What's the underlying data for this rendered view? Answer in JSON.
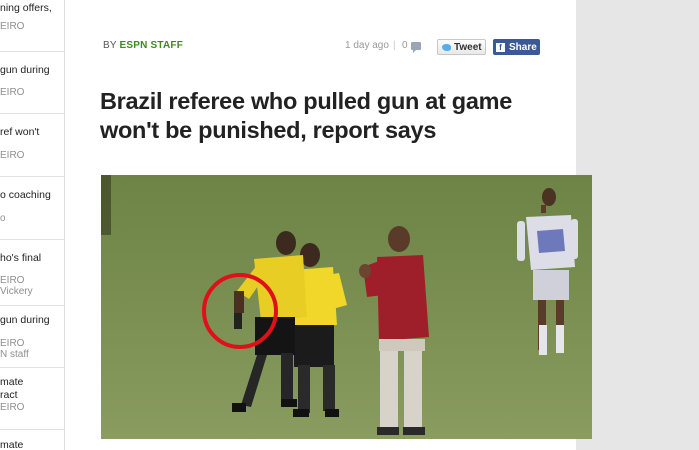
{
  "sidebar": {
    "items": [
      {
        "title": "ning offers,",
        "meta": "EIRO",
        "meta2": ""
      },
      {
        "title": "gun during",
        "meta": "EIRO",
        "meta2": ""
      },
      {
        "title": "ref won't",
        "meta": "EIRO",
        "meta2": ""
      },
      {
        "title": "o coaching",
        "meta": "o",
        "meta2": ""
      },
      {
        "title": "ho's final",
        "meta": "EIRO",
        "meta2": "Vickery"
      },
      {
        "title": "gun during",
        "meta": "EIRO",
        "meta2": "N staff"
      },
      {
        "title": "mate",
        "title2": "ract",
        "meta": "EIRO",
        "meta2": ""
      },
      {
        "title": "mate",
        "meta": "",
        "meta2": ""
      }
    ]
  },
  "article": {
    "byline_prefix": "BY",
    "author": "ESPN STAFF",
    "timestamp": "1 day ago",
    "divider": "|",
    "comment_count": "0",
    "tweet_label": "Tweet",
    "share_label": "Share",
    "headline": "Brazil referee who pulled gun at game won't be punished, report says"
  },
  "icons": {
    "comment": "comment-icon",
    "tweet": "twitter-bird-icon",
    "share": "facebook-icon"
  },
  "colors": {
    "author_green": "#3f8a1e",
    "facebook_blue": "#3b5998",
    "twitter_blue": "#55acee",
    "highlight_circle": "#e0101a"
  }
}
